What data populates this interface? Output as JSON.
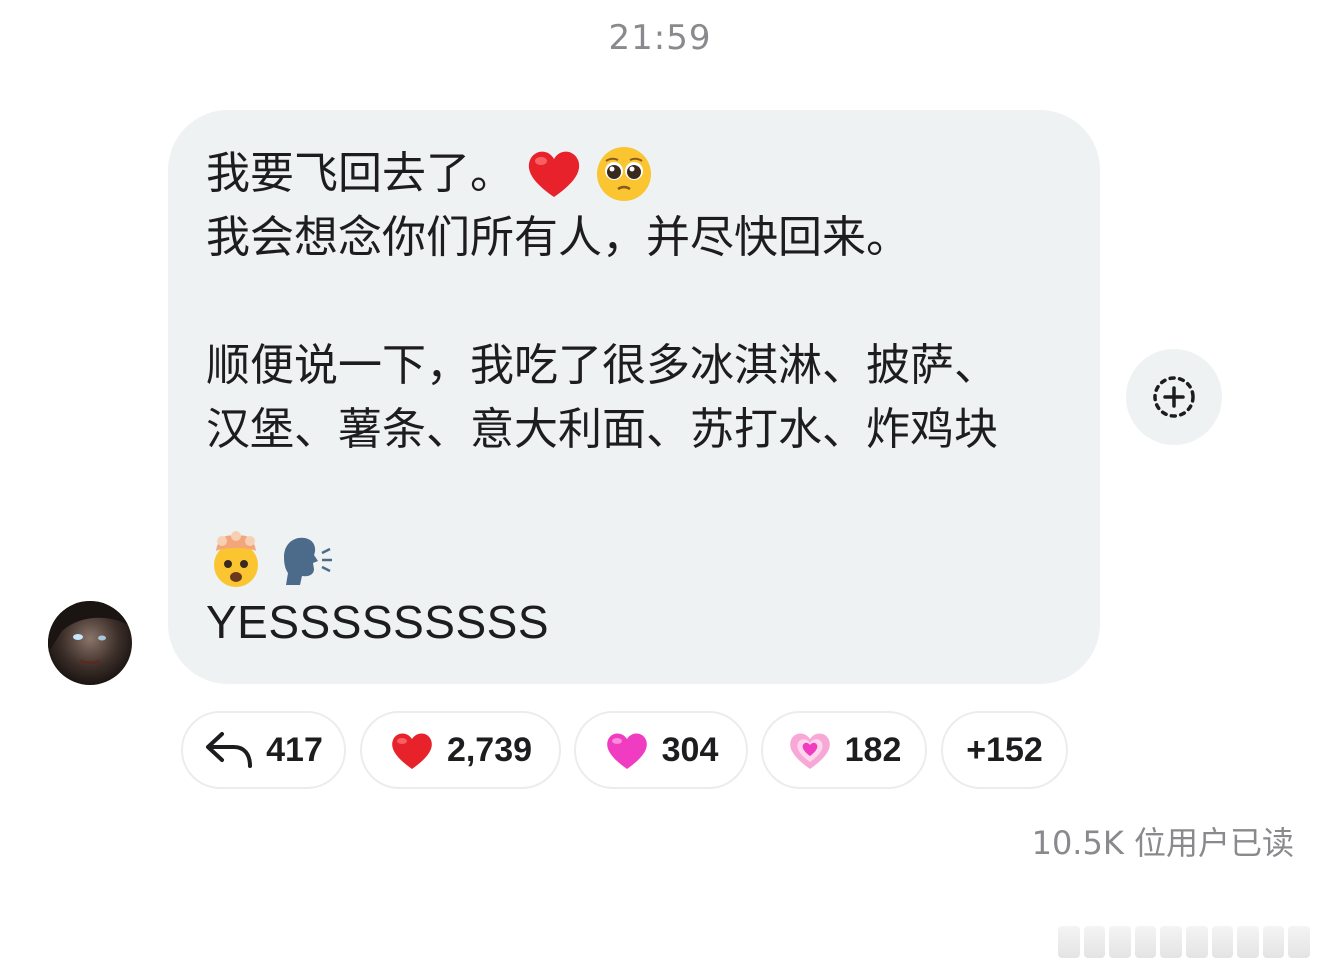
{
  "message": {
    "timestamp": "21:59",
    "line1": "我要飞回去了。",
    "line2": "我会想念你们所有人，并尽快回来。",
    "line3": "顺便说一下，我吃了很多冰淇淋、披萨、",
    "line4": "汉堡、薯条、意大利面、苏打水、炸鸡块",
    "line5": "YESSSSSSSSS",
    "line1_emojis": [
      "red-heart-emoji",
      "pleading-face-emoji"
    ],
    "line5_emojis": [
      "exploding-head-emoji",
      "speaking-head-emoji"
    ]
  },
  "reactions": [
    {
      "icon": "reply-arrow-icon",
      "count": "417"
    },
    {
      "icon": "red-heart-icon",
      "count": "2,739"
    },
    {
      "icon": "pink-heart-icon",
      "count": "304"
    },
    {
      "icon": "sparkling-heart-icon",
      "count": "182"
    },
    {
      "icon": "",
      "count": "+152"
    }
  ],
  "read_receipt": "10.5K 位用户已读",
  "colors": {
    "bubble": "#eef2f3",
    "secondary_text": "#8a8a8e",
    "pill_border": "#ececee",
    "heart_red": "#e8222a",
    "heart_pink": "#f03cc0"
  }
}
